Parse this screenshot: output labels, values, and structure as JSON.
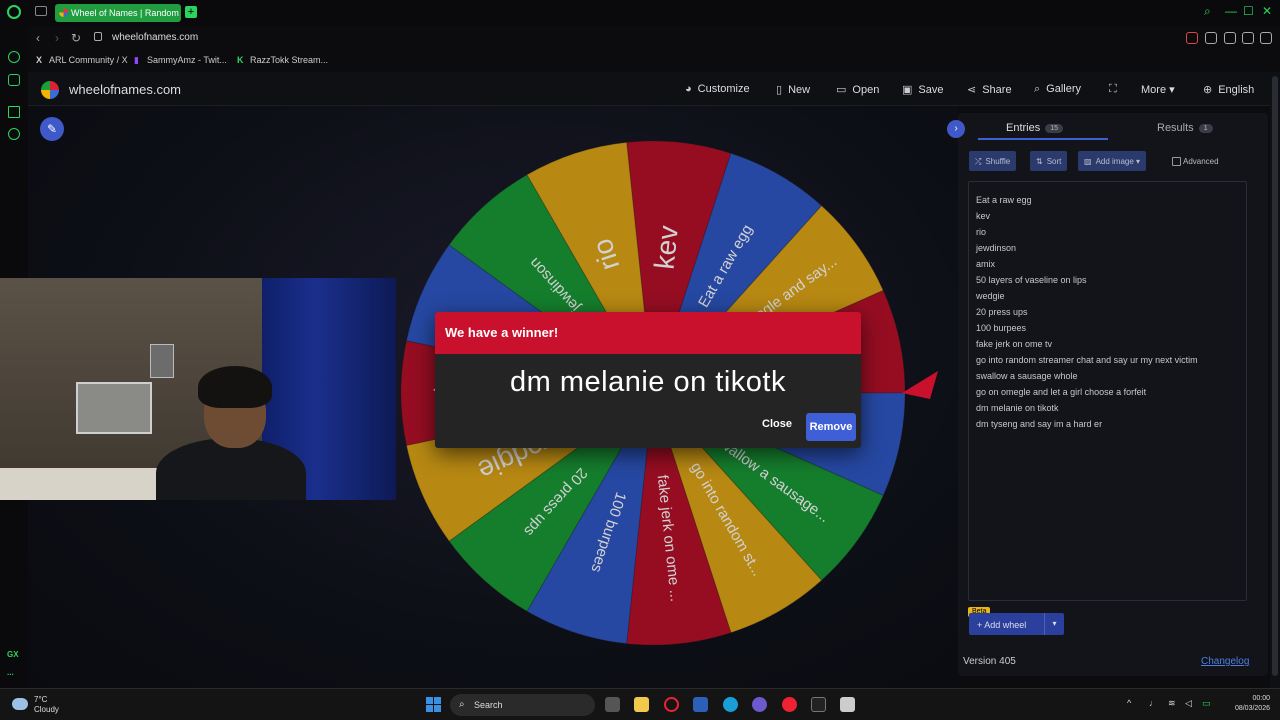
{
  "browser": {
    "tab_title": "Wheel of Names | Random",
    "url": "wheelofnames.com",
    "bookmarks": [
      "ARL Community / X",
      "SammyAmz - Twit...",
      "RazzTokk Stream..."
    ],
    "sidebar_badge": "GX",
    "sidebar_more": "..."
  },
  "site": {
    "title": "wheelofnames.com",
    "menu": {
      "customize": "Customize",
      "new": "New",
      "open": "Open",
      "save": "Save",
      "share": "Share",
      "gallery": "Gallery",
      "more": "More",
      "language": "English"
    }
  },
  "wheel": {
    "colors": [
      "#b8102a",
      "#2f58c6",
      "#e0a616",
      "#1a9a38"
    ],
    "slices": [
      {
        "label": "kev",
        "color": "#b8102a"
      },
      {
        "label": "Eat a raw egg",
        "color": "#2f58c6"
      },
      {
        "label": "go on omegle and say...",
        "color": "#e0a616"
      },
      {
        "label": "dm melanie on tik...",
        "color": "#b8102a"
      },
      {
        "label": "dm tyseng and ...",
        "color": "#2f58c6"
      },
      {
        "label": "swallow a sausage...",
        "color": "#1a9a38"
      },
      {
        "label": "go into random st...",
        "color": "#e0a616"
      },
      {
        "label": "fake jerk on ome ...",
        "color": "#b8102a"
      },
      {
        "label": "100 burpees",
        "color": "#2f58c6"
      },
      {
        "label": "20 press ups",
        "color": "#1a9a38"
      },
      {
        "label": "wedgie",
        "color": "#e0a616"
      },
      {
        "label": "50 layers of vaseline...",
        "color": "#b8102a"
      },
      {
        "label": "amix",
        "color": "#2f58c6"
      },
      {
        "label": "jewdinson",
        "color": "#1a9a38"
      },
      {
        "label": "rio",
        "color": "#e0a616"
      }
    ]
  },
  "dialog": {
    "header": "We have a winner!",
    "winner": "dm melanie on tikotk",
    "close": "Close",
    "remove": "Remove"
  },
  "panel": {
    "entries_tab": "Entries",
    "entries_count": "15",
    "results_tab": "Results",
    "results_count": "1",
    "shuffle": "Shuffle",
    "sort": "Sort",
    "add_image": "Add image",
    "advanced": "Advanced",
    "entries": [
      "Eat a raw egg",
      "kev",
      "rio",
      "jewdinson",
      "amix",
      "50 layers of vaseline on lips",
      "wedgie",
      "20 press ups",
      "100 burpees",
      "fake jerk on ome tv",
      "go into random streamer chat and say ur my next victim",
      "swallow a sausage whole",
      "go on omegle and let a girl choose a forfeit",
      "dm melanie on tikotk",
      "dm tyseng and say im a hard er"
    ],
    "beta": "Beta",
    "add_wheel": "Add wheel",
    "version": "Version 405",
    "changelog": "Changelog"
  },
  "taskbar": {
    "temp": "7°C",
    "weather": "Cloudy",
    "search": "Search",
    "time": "00:00",
    "date": "08/03/2026"
  }
}
